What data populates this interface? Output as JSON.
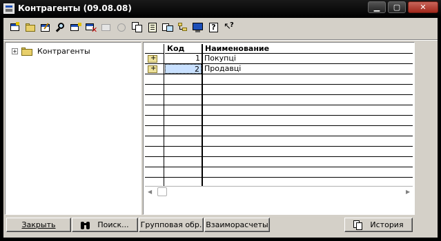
{
  "window": {
    "title": "Контрагенты (09.08.08)",
    "minimize": "▁",
    "maximize": "▢",
    "close": "✕"
  },
  "toolbar": {
    "icons": [
      "new-record-icon",
      "new-folder-icon",
      "edit-icon",
      "find-icon",
      "new-copy-icon",
      "delete-icon",
      "disabled-icon-1",
      "disabled-icon-2",
      "copy-icon",
      "paste-icon",
      "move-icon",
      "tree-toggle-icon",
      "list-mode-icon",
      "help-icon",
      "context-help-icon"
    ]
  },
  "tree": {
    "root_label": "Контрагенты",
    "expand": "+"
  },
  "grid": {
    "columns": [
      "Код",
      "Наименование"
    ],
    "rows": [
      {
        "code": "1",
        "name": "Покупці"
      },
      {
        "code": "2",
        "name": "Продавці"
      }
    ]
  },
  "buttons": {
    "close_label": "Закрыть",
    "search_label": "Поиск...",
    "group_label": "Групповая обр.",
    "mutual_label": "Взаиморасчеты",
    "history_label": "История"
  }
}
